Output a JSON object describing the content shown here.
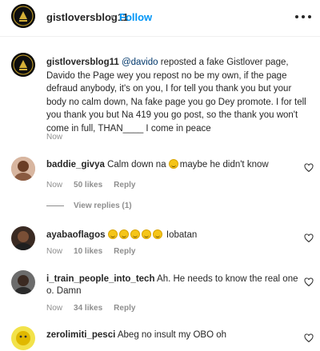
{
  "header": {
    "username": "gistloversblog11",
    "separator": "•",
    "follow_label": "Follow",
    "more_icon": "more-horizontal-icon"
  },
  "caption": {
    "username": "gistloversblog11",
    "mention": "@davido",
    "text": "reposted a fake Gistlover page, Davido the Page wey you repost no be my own, if the page defraud anybody, it's on you, I for tell you thank you but your body no calm down, Na fake page you go Dey promote. I for tell you thank you but Na 419 you go post, so the thank you won't come in full, THAN____ I come in peace",
    "time": "Now"
  },
  "comments": [
    {
      "username": "baddie_givya",
      "text_before": "Calm down na",
      "emoji_count": 1,
      "text_after": "maybe he didn't know",
      "time": "Now",
      "likes": "50 likes",
      "reply_label": "Reply",
      "view_replies": "View replies (1)"
    },
    {
      "username": "ayabaoflagos",
      "text_before": "",
      "emoji_count": 5,
      "text_after": "Iobatan",
      "time": "Now",
      "likes": "10 likes",
      "reply_label": "Reply"
    },
    {
      "username": "i_train_people_into_tech",
      "text_before": "Ah. He needs to know the real one o. Damn",
      "emoji_count": 0,
      "text_after": "",
      "time": "Now",
      "likes": "34 likes",
      "reply_label": "Reply"
    },
    {
      "username": "zerolimiti_pesci",
      "text_before": "Abeg no insult my OBO oh",
      "emoji_count": 0,
      "text_after": "",
      "time": "",
      "likes": "",
      "reply_label": ""
    }
  ],
  "colors": {
    "link": "#0095f6",
    "mention": "#00376b",
    "muted": "#8e8e8e",
    "text": "#262626"
  }
}
